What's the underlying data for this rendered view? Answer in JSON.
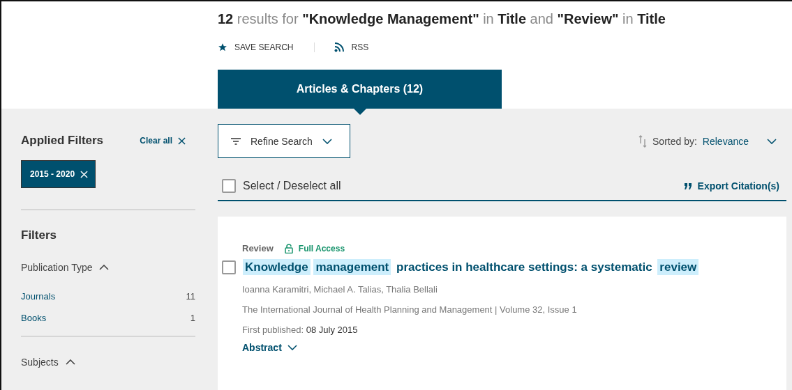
{
  "heading": "**12** results for **\"Knowledge Management\"** in **Title** and **\"Review\"** in **Title**",
  "actions": [
    {
      "kind": "star",
      "label": "SAVE SEARCH"
    },
    {
      "kind": "rss",
      "label": "RSS"
    }
  ],
  "tabs": [
    {
      "label": "Articles & Chapters (12)",
      "selected": true
    }
  ],
  "sidebar": {
    "applied_title": "Applied Filters",
    "clear_all": "Clear all",
    "applied": [
      "2015 - 2020"
    ],
    "filters_title": "Filters",
    "groups": [
      {
        "title": "Publication Type",
        "expanded": true,
        "items": [
          {
            "label": "Journals",
            "count": "11"
          },
          {
            "label": "Books",
            "count": "1"
          }
        ]
      },
      {
        "title": "Subjects",
        "expanded": true
      }
    ]
  },
  "refine": "Refine Search",
  "sort": {
    "label": "Sorted by:",
    "value": "Relevance"
  },
  "select_all": {
    "label": "Select / Deselect all",
    "checked": false
  },
  "export": "Export Citation(s)",
  "results": [
    {
      "type": "Review",
      "access": "Full Access",
      "checked": false,
      "title": [
        {
          "text": "Knowledge",
          "highlighted": true
        },
        {
          "text": "management",
          "highlighted": true
        },
        {
          "text": "practices in healthcare settings: a systematic",
          "highlighted": false
        },
        {
          "text": "review",
          "highlighted": true
        }
      ],
      "authors": "Ioanna Karamitri, Michael A. Talias, Thalia Bellali",
      "journal": "The International Journal of Health Planning and Management | Volume 32, Issue 1",
      "published_label": "First published:",
      "published": "08 July 2015",
      "abstract": "Abstract"
    }
  ]
}
